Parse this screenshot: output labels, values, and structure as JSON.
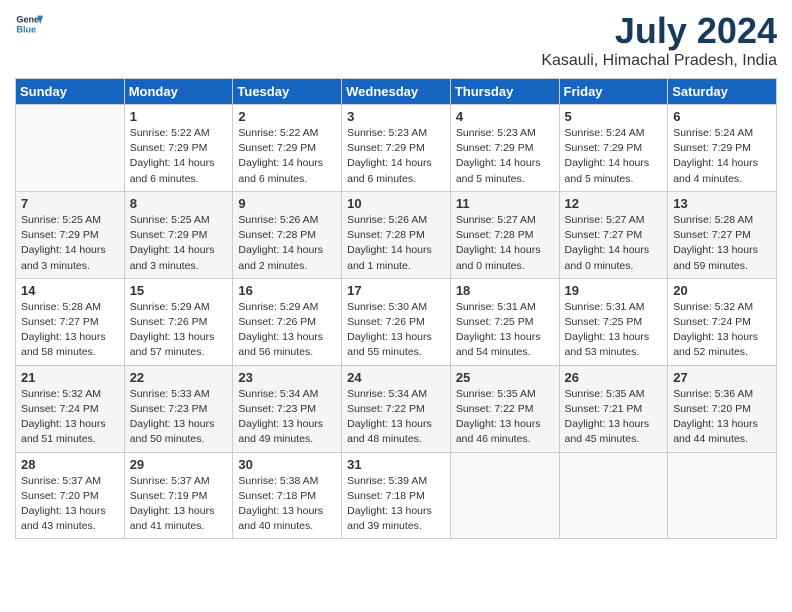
{
  "header": {
    "logo_line1": "General",
    "logo_line2": "Blue",
    "title": "July 2024",
    "subtitle": "Kasauli, Himachal Pradesh, India"
  },
  "days_of_week": [
    "Sunday",
    "Monday",
    "Tuesday",
    "Wednesday",
    "Thursday",
    "Friday",
    "Saturday"
  ],
  "weeks": [
    [
      {
        "day": "",
        "info": ""
      },
      {
        "day": "1",
        "info": "Sunrise: 5:22 AM\nSunset: 7:29 PM\nDaylight: 14 hours\nand 6 minutes."
      },
      {
        "day": "2",
        "info": "Sunrise: 5:22 AM\nSunset: 7:29 PM\nDaylight: 14 hours\nand 6 minutes."
      },
      {
        "day": "3",
        "info": "Sunrise: 5:23 AM\nSunset: 7:29 PM\nDaylight: 14 hours\nand 6 minutes."
      },
      {
        "day": "4",
        "info": "Sunrise: 5:23 AM\nSunset: 7:29 PM\nDaylight: 14 hours\nand 5 minutes."
      },
      {
        "day": "5",
        "info": "Sunrise: 5:24 AM\nSunset: 7:29 PM\nDaylight: 14 hours\nand 5 minutes."
      },
      {
        "day": "6",
        "info": "Sunrise: 5:24 AM\nSunset: 7:29 PM\nDaylight: 14 hours\nand 4 minutes."
      }
    ],
    [
      {
        "day": "7",
        "info": "Sunrise: 5:25 AM\nSunset: 7:29 PM\nDaylight: 14 hours\nand 3 minutes."
      },
      {
        "day": "8",
        "info": "Sunrise: 5:25 AM\nSunset: 7:29 PM\nDaylight: 14 hours\nand 3 minutes."
      },
      {
        "day": "9",
        "info": "Sunrise: 5:26 AM\nSunset: 7:28 PM\nDaylight: 14 hours\nand 2 minutes."
      },
      {
        "day": "10",
        "info": "Sunrise: 5:26 AM\nSunset: 7:28 PM\nDaylight: 14 hours\nand 1 minute."
      },
      {
        "day": "11",
        "info": "Sunrise: 5:27 AM\nSunset: 7:28 PM\nDaylight: 14 hours\nand 0 minutes."
      },
      {
        "day": "12",
        "info": "Sunrise: 5:27 AM\nSunset: 7:27 PM\nDaylight: 14 hours\nand 0 minutes."
      },
      {
        "day": "13",
        "info": "Sunrise: 5:28 AM\nSunset: 7:27 PM\nDaylight: 13 hours\nand 59 minutes."
      }
    ],
    [
      {
        "day": "14",
        "info": "Sunrise: 5:28 AM\nSunset: 7:27 PM\nDaylight: 13 hours\nand 58 minutes."
      },
      {
        "day": "15",
        "info": "Sunrise: 5:29 AM\nSunset: 7:26 PM\nDaylight: 13 hours\nand 57 minutes."
      },
      {
        "day": "16",
        "info": "Sunrise: 5:29 AM\nSunset: 7:26 PM\nDaylight: 13 hours\nand 56 minutes."
      },
      {
        "day": "17",
        "info": "Sunrise: 5:30 AM\nSunset: 7:26 PM\nDaylight: 13 hours\nand 55 minutes."
      },
      {
        "day": "18",
        "info": "Sunrise: 5:31 AM\nSunset: 7:25 PM\nDaylight: 13 hours\nand 54 minutes."
      },
      {
        "day": "19",
        "info": "Sunrise: 5:31 AM\nSunset: 7:25 PM\nDaylight: 13 hours\nand 53 minutes."
      },
      {
        "day": "20",
        "info": "Sunrise: 5:32 AM\nSunset: 7:24 PM\nDaylight: 13 hours\nand 52 minutes."
      }
    ],
    [
      {
        "day": "21",
        "info": "Sunrise: 5:32 AM\nSunset: 7:24 PM\nDaylight: 13 hours\nand 51 minutes."
      },
      {
        "day": "22",
        "info": "Sunrise: 5:33 AM\nSunset: 7:23 PM\nDaylight: 13 hours\nand 50 minutes."
      },
      {
        "day": "23",
        "info": "Sunrise: 5:34 AM\nSunset: 7:23 PM\nDaylight: 13 hours\nand 49 minutes."
      },
      {
        "day": "24",
        "info": "Sunrise: 5:34 AM\nSunset: 7:22 PM\nDaylight: 13 hours\nand 48 minutes."
      },
      {
        "day": "25",
        "info": "Sunrise: 5:35 AM\nSunset: 7:22 PM\nDaylight: 13 hours\nand 46 minutes."
      },
      {
        "day": "26",
        "info": "Sunrise: 5:35 AM\nSunset: 7:21 PM\nDaylight: 13 hours\nand 45 minutes."
      },
      {
        "day": "27",
        "info": "Sunrise: 5:36 AM\nSunset: 7:20 PM\nDaylight: 13 hours\nand 44 minutes."
      }
    ],
    [
      {
        "day": "28",
        "info": "Sunrise: 5:37 AM\nSunset: 7:20 PM\nDaylight: 13 hours\nand 43 minutes."
      },
      {
        "day": "29",
        "info": "Sunrise: 5:37 AM\nSunset: 7:19 PM\nDaylight: 13 hours\nand 41 minutes."
      },
      {
        "day": "30",
        "info": "Sunrise: 5:38 AM\nSunset: 7:18 PM\nDaylight: 13 hours\nand 40 minutes."
      },
      {
        "day": "31",
        "info": "Sunrise: 5:39 AM\nSunset: 7:18 PM\nDaylight: 13 hours\nand 39 minutes."
      },
      {
        "day": "",
        "info": ""
      },
      {
        "day": "",
        "info": ""
      },
      {
        "day": "",
        "info": ""
      }
    ]
  ]
}
